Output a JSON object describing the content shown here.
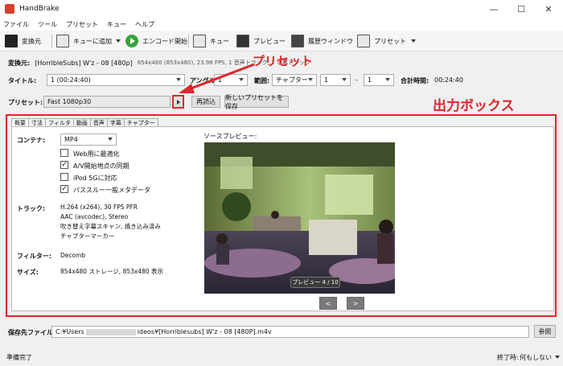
{
  "app": {
    "title": "HandBrake"
  },
  "window_controls": {
    "minimize": "—",
    "maximize": "☐",
    "close": "✕"
  },
  "menu": [
    "ファイル",
    "ツール",
    "プリセット",
    "キュー",
    "ヘルプ"
  ],
  "toolbar": {
    "source": "変換元",
    "add_queue": "キューに追加",
    "start": "エンコード開始",
    "queue": "キュー",
    "preview": "プレビュー",
    "activity": "履歴ウィンドウ",
    "presets": "プリセット"
  },
  "source_info": {
    "label": "変換元:",
    "value": "[HorribleSubs] W'z - 08 [480p]",
    "details": "854x480 (853x480), 23.98 FPS, 1 音声トラック, 1 字幕トラック"
  },
  "title_row": {
    "title_label": "タイトル:",
    "title_value": "1 (00:24:40)",
    "angle_label": "アングル:",
    "angle_value": "1",
    "range_label": "範囲:",
    "range_value": "チャプター",
    "range_start": "1",
    "range_dash": "-",
    "range_end": "1",
    "duration_label": "合計時間:",
    "duration_value": "00:24:40"
  },
  "preset_row": {
    "label": "プリセット:",
    "value": "Fast 1080p30",
    "reload": "再読込",
    "save_new": "新しいプリセットを保存"
  },
  "annotations": {
    "preset": "プリセット",
    "output_box": "出力ボックス",
    "color": "#e0262a"
  },
  "tabs": [
    "概要",
    "寸法",
    "フィルタ",
    "動画",
    "音声",
    "字幕",
    "チャプター"
  ],
  "summary": {
    "container_label": "コンテナ:",
    "container_value": "MP4",
    "options": [
      {
        "label": "Web用に最適化",
        "checked": false
      },
      {
        "label": "A/V開始地点の同期",
        "checked": true
      },
      {
        "label": "iPod 5Gに対応",
        "checked": false
      },
      {
        "label": "パススルー一般メタデータ",
        "checked": true
      }
    ],
    "tracks_label": "トラック:",
    "tracks": [
      "H.264 (x264), 30 FPS PFR",
      "AAC (avcodec), Stereo",
      "吹き替え字幕スキャン, 焼き込み済み",
      "チャプターマーカー"
    ],
    "filters_label": "フィルター:",
    "filters_value": "Decomb",
    "size_label": "サイズ:",
    "size_value": "854x480 ストレージ, 853x480 表示",
    "preview_label": "ソースプレビュー:",
    "preview_counter": "プレビュー 4 / 10",
    "prev": "<",
    "next": ">"
  },
  "destination": {
    "label": "保存先ファイル:",
    "path_start": "C:¥Users",
    "path_end": "ideos¥[Horriblesubs] W'z - 08 [480P].m4v",
    "browse": "参照"
  },
  "status": {
    "text": "準備完了",
    "when_done_label": "終了時:",
    "when_done_value": "何もしない"
  }
}
